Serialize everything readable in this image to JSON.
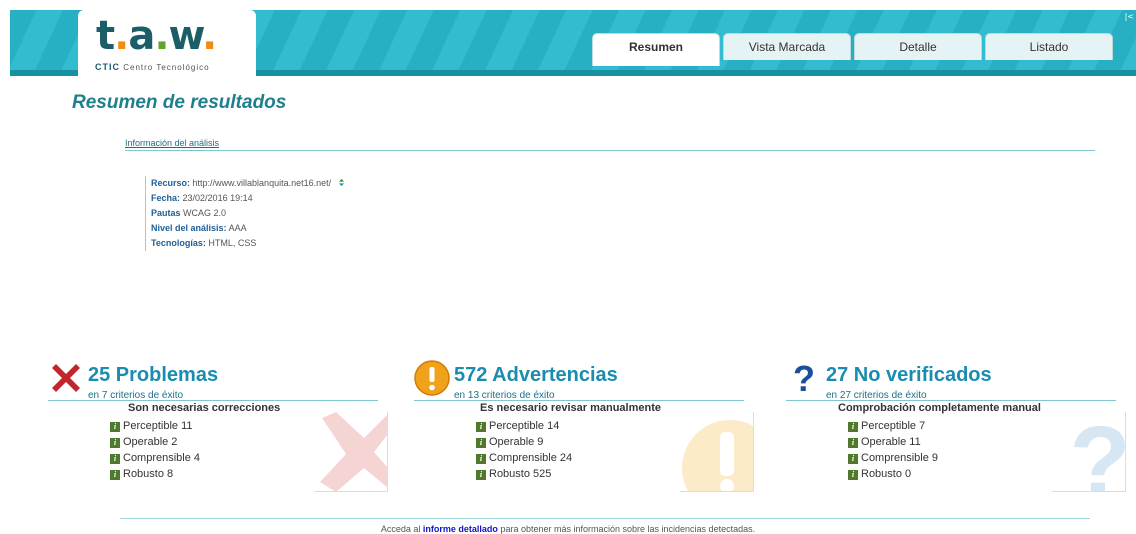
{
  "logo": {
    "letters": [
      "t",
      ".",
      "a",
      ".",
      "w",
      "."
    ],
    "subtitle_strong": "CTIC",
    "subtitle_rest": "Centro Tecnológico"
  },
  "tabs": [
    {
      "label": "Resumen",
      "active": true
    },
    {
      "label": "Vista Marcada",
      "active": false
    },
    {
      "label": "Detalle",
      "active": false
    },
    {
      "label": "Listado",
      "active": false
    }
  ],
  "page_title": "Resumen de resultados",
  "info": {
    "heading": "Información del análisis",
    "fields": [
      {
        "label": "Recurso:",
        "value": "http://www.villablanquita.net16.net/"
      },
      {
        "label": "Fecha:",
        "value": "23/02/2016 19:14"
      },
      {
        "label": "Pautas",
        "value": "WCAG 2.0"
      },
      {
        "label": "Nivel del análisis:",
        "value": "AAA"
      },
      {
        "label": "Tecnologías:",
        "value": "HTML, CSS"
      }
    ]
  },
  "panels": [
    {
      "icon": "red-x-icon",
      "count": "25 Problemas",
      "sub": "en 7 criterios de éxito",
      "label": "Son necesarias correcciones",
      "items": [
        "Perceptible 11",
        "Operable 2",
        "Comprensible 4",
        "Robusto 8"
      ]
    },
    {
      "icon": "warning-icon",
      "count": "572 Advertencias",
      "sub": "en 13 criterios de éxito",
      "label": "Es necesario revisar manualmente",
      "items": [
        "Perceptible 14",
        "Operable 9",
        "Comprensible 24",
        "Robusto 525"
      ]
    },
    {
      "icon": "question-icon",
      "count": "27 No verificados",
      "sub": "en 27 criterios de éxito",
      "label": "Comprobación completamente manual",
      "items": [
        "Perceptible 7",
        "Operable 11",
        "Comprensible 9",
        "Robusto 0"
      ]
    }
  ],
  "footer": {
    "before": "Acceda al",
    "link": "informe detallado",
    "after": "para obtener más información sobre las incidencias detectadas."
  },
  "edge_mark": "|<",
  "colors": {
    "header": "#27b0c4",
    "accent": "#1a8cb0",
    "error": "#c0262c",
    "warning": "#f0a21b",
    "question": "#1b4f9c"
  }
}
